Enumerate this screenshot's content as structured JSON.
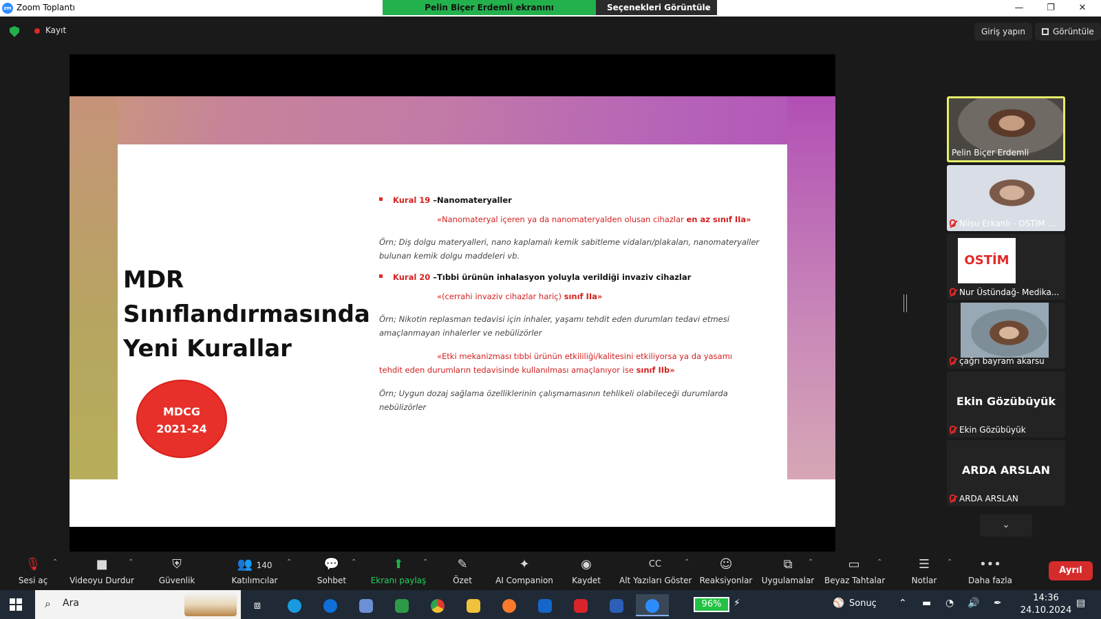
{
  "window": {
    "app_title": "Zoom Toplantı",
    "share_banner": "Pelin Biçer Erdemli ekranını görüntülüyorsunuz",
    "view_options": "Seçenekleri Görüntüle",
    "minimize": "—",
    "restore": "❐",
    "close": "✕"
  },
  "meeting_top": {
    "recording": "Kayıt",
    "sign_in": "Giriş yapın",
    "view": "Görüntüle"
  },
  "slide": {
    "title_lines": [
      "MDR",
      "Sınıflandırmasında",
      "Yeni Kurallar"
    ],
    "badge_lines": [
      "MDCG",
      "2021-24"
    ],
    "rule19_num": "Kural 19",
    "rule19_title": " –Nanomateryaller",
    "rule19_quote_a": "«Nanomateryal içeren ya da nanomateryalden olusan  cihazlar ",
    "rule19_quote_b": "en az sınıf IIa»",
    "rule19_example": "Örn; Diş dolgu materyalleri, nano kaplamalı kemik sabitleme vidaları/plakaları, nanomateryaller bulunan kemik dolgu maddeleri vb.",
    "rule20_num": "Kural 20",
    "rule20_title": " –Tıbbi ürünün inhalasyon yoluyla verildiği invaziv cihazlar",
    "rule20_quote_a": "«(cerrahi invaziv cihazlar hariç) ",
    "rule20_quote_b": "sınıf IIa»",
    "rule20_example1": "Örn; Nikotin replasman tedavisi için inhaler, yaşamı tehdit eden durumları tedavi etmesi amaçlanmayan inhalerler ve nebülizörler",
    "rule20_quote2_line1": "«Etki mekanizması tıbbi ürünün etkililiği/kalitesini etkiliyorsa ya da yasamı",
    "rule20_quote2_line2a": "tehdit eden durumların tedavisinde kullanılması amaçlanıyor ise ",
    "rule20_quote2_line2b": "sınıf IIb»",
    "rule20_example2": "Örn; Uygun dozaj sağlama özelliklerinin çalışmamasının tehlikeli olabileceği durumlarda nebülizörler"
  },
  "participants": [
    {
      "name": "Pelin Biçer Erdemli"
    },
    {
      "name": "Nilsu Erkanlı - OSTİM ..."
    },
    {
      "name": "Nur Üstündağ- Medika...",
      "logo": "OSTİM"
    },
    {
      "name": "çağrı bayram akarsu"
    },
    {
      "name": "Ekin Gözübüyük",
      "display": "Ekin Gözübüyük"
    },
    {
      "name": "ARDA ARSLAN",
      "display": "ARDA ARSLAN"
    }
  ],
  "controls": {
    "unmute": "Sesi aç",
    "stop_video": "Videoyu Durdur",
    "security": "Güvenlik",
    "participants": "Katılımcılar",
    "participants_count": "140",
    "chat": "Sohbet",
    "share": "Ekranı paylaş",
    "summary": "Özet",
    "ai": "AI Companion",
    "record": "Kaydet",
    "captions": "Alt Yazıları Göster",
    "reactions": "Reaksiyonlar",
    "apps": "Uygulamalar",
    "whiteboards": "Beyaz Tahtalar",
    "notes": "Notlar",
    "more": "Daha fazla",
    "leave": "Ayrıl"
  },
  "taskbar": {
    "search_placeholder": "Ara",
    "battery": "96%",
    "sports": "Sonuç",
    "time": "14:36",
    "date": "24.10.2024"
  },
  "colors": {
    "accent_green": "#23b14d",
    "danger_red": "#d62b2b",
    "slide_red": "#d41f1f"
  }
}
